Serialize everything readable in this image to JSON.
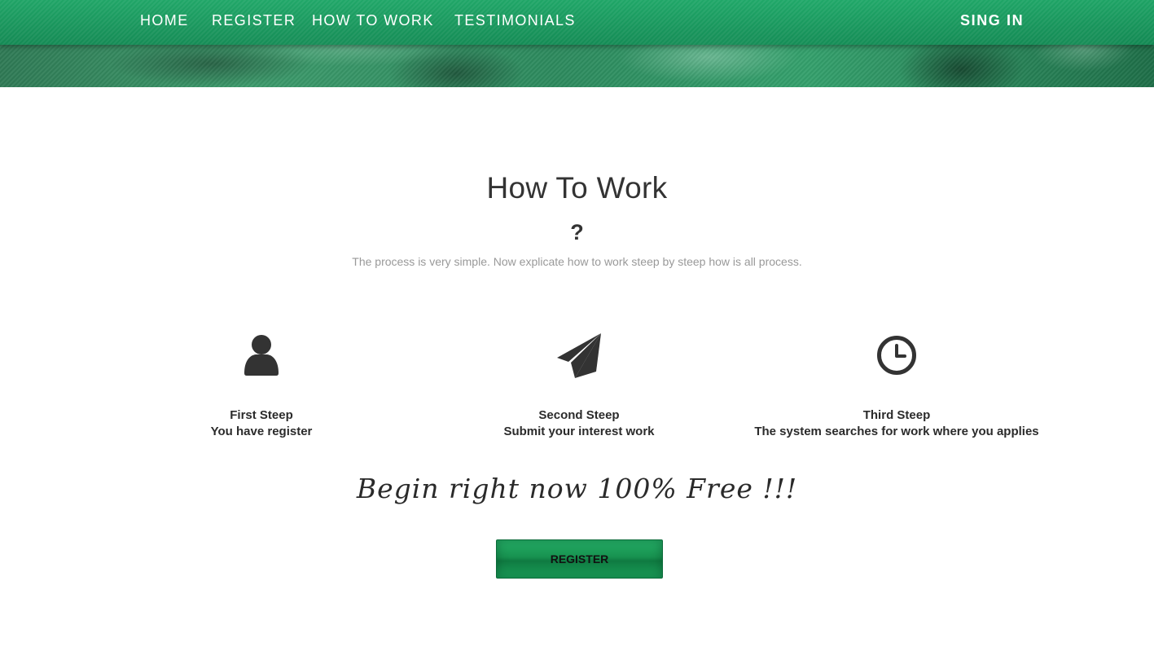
{
  "nav": {
    "home": "HOME",
    "register": "REGISTER",
    "how_to_work": "HOW TO WORK",
    "testimonials": "TESTIMONIALS",
    "sign_in": "SING IN"
  },
  "section": {
    "title": "How To Work",
    "question_mark": "?",
    "description": "The process is very simple. Now explicate how to work steep by steep how is all process."
  },
  "steps": [
    {
      "icon": "user-icon",
      "title": "First Steep",
      "text": "You have register"
    },
    {
      "icon": "paper-plane-icon",
      "title": "Second Steep",
      "text": "Submit your interest work"
    },
    {
      "icon": "clock-icon",
      "title": "Third Steep",
      "text": "The system searches for work where you applies"
    }
  ],
  "cta": {
    "text": "Begin right now 100% Free !!!",
    "button_label": "REGISTER"
  },
  "colors": {
    "brand_green": "#1a9a5a",
    "text_dark": "#333333",
    "text_muted": "#999999"
  }
}
